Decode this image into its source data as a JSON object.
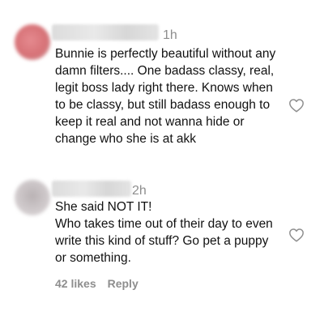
{
  "comments": [
    {
      "time": "1h",
      "text": "Bunnie is perfectly beautiful without any damn filters.... One badass classy, real, legit boss lady right there. Knows when to be classy, but still badass enough to keep it real and not wanna hide or change who she is at akk"
    },
    {
      "time": "2h",
      "text": "She said NOT IT!\nWho takes time out of their day to even write this kind of stuff? Go pet a puppy or something.",
      "likes": "42 likes",
      "reply_label": "Reply"
    }
  ],
  "icons": {
    "like": "heart-outline-icon"
  },
  "colors": {
    "text": "#111111",
    "muted": "#8e8e8e",
    "background": "#ffffff"
  }
}
